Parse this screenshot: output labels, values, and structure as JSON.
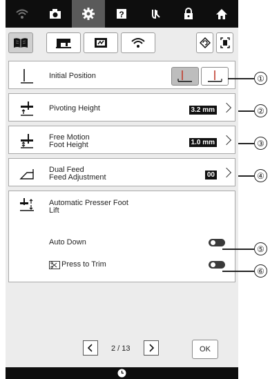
{
  "topbar": {
    "icons": [
      "wifi-icon",
      "camera-icon",
      "settings-icon",
      "help-icon",
      "needle-threading-icon",
      "lock-icon",
      "home-icon"
    ],
    "active_index": 2
  },
  "tabs": {
    "icons": [
      "book-icon",
      "sewing-machine-icon",
      "embroidery-icon",
      "wifi-icon",
      "settings-reset-icon",
      "fullscreen-icon"
    ],
    "active_index": 0
  },
  "settings": {
    "initial_position": {
      "label": "Initial Position"
    },
    "pivoting_height": {
      "label": "Pivoting Height",
      "value": "3.2 mm"
    },
    "free_motion": {
      "label_line1": "Free Motion",
      "label_line2": "Foot Height",
      "value": "1.0 mm"
    },
    "dual_feed": {
      "label_line1": "Dual Feed",
      "label_line2": "Feed Adjustment",
      "value": "00"
    },
    "auto_lift": {
      "label_line1": "Automatic Presser Foot",
      "label_line2": "Lift",
      "auto_down": {
        "label": "Auto Down",
        "on": false
      },
      "press_to_trim": {
        "label": "Press to Trim",
        "on": false
      }
    }
  },
  "pager": {
    "text": "2 / 13"
  },
  "ok_label": "OK",
  "callouts": [
    "①",
    "②",
    "③",
    "④",
    "⑤",
    "⑥"
  ]
}
